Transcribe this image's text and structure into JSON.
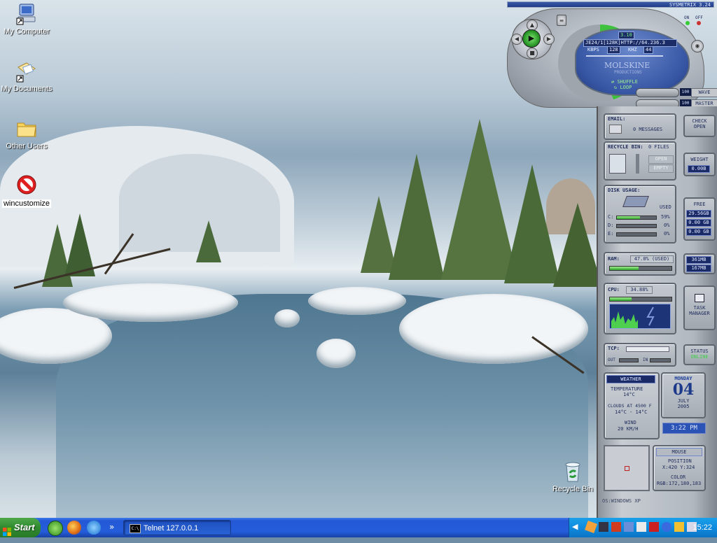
{
  "desktop": {
    "icons": [
      {
        "label": "My Computer",
        "icon": "my-computer-icon"
      },
      {
        "label": "My Documents",
        "icon": "my-documents-icon"
      },
      {
        "label": "Other Users",
        "icon": "folder-icon"
      },
      {
        "label": "wincustomize",
        "icon": "no-entry-icon"
      },
      {
        "label": "Recycle Bin",
        "icon": "recycle-bin-icon"
      }
    ]
  },
  "widget": {
    "title": "SYSMETRIX 3.24",
    "player": {
      "track_num": "3.10",
      "stream": "JE24/1[128K]HTTP://64.236.3",
      "kbps_label": "KBPS",
      "kbps": "128",
      "khz_label": "KHZ",
      "khz": "44",
      "logo_text": "MOLSKINE",
      "logo_sub": "PRODUCTIONS",
      "shuffle": "SHUFFLE",
      "loop": "LOOP",
      "on_label": "ON",
      "off_label": "OFF"
    },
    "volume": {
      "wave_value": "100",
      "wave_label": "WAVE",
      "master_value": "100",
      "master_label": "MASTER"
    },
    "email": {
      "title": "EMAIL:",
      "messages": "0 MESSAGES",
      "check": "CHECK",
      "open": "OPEN"
    },
    "recycle": {
      "title": "RECYCLE BIN:",
      "files": "0 FILES",
      "open": "OPEN",
      "empty": "EMPTY",
      "weight_label": "WEIGHT",
      "weight": "0.00B"
    },
    "disk": {
      "title": "DISK USAGE:",
      "used_label": "USED",
      "free_label": "FREE",
      "drives": [
        {
          "letter": "C:",
          "used": "59%",
          "used_fraction": 0.59,
          "free": "29.56GB"
        },
        {
          "letter": "D:",
          "used": "0%",
          "used_fraction": 0,
          "free": "0.00 GB"
        },
        {
          "letter": "E:",
          "used": "0%",
          "used_fraction": 0,
          "free": "0.00 GB"
        }
      ]
    },
    "ram": {
      "label": "RAM:",
      "value": "47.0% (USED)",
      "used_fraction": 0.47,
      "total": "361MB",
      "free": "167MB"
    },
    "cpu": {
      "label": "CPU:",
      "value": "34.88%",
      "used_fraction": 0.3488
    },
    "task_manager": {
      "line1": "TASK",
      "line2": "MANAGER"
    },
    "tcp": {
      "label": "TCP:",
      "out": "OUT",
      "in": "IN",
      "status_label": "STATUS",
      "status": "ONLINE"
    },
    "weather": {
      "title": "WEATHER",
      "temp_label": "TEMPERATURE",
      "temp": "14°C",
      "clouds": "CLOUDS AT 4500 F",
      "clouds_range": "14°C - 14°C",
      "wind_label": "WIND",
      "wind": "20 KM/H"
    },
    "date": {
      "day": "MONDAY",
      "date": "04",
      "month": "JULY",
      "year": "2005",
      "time": "3:22 PM"
    },
    "mouse": {
      "title": "MOUSE",
      "position_label": "POSITION",
      "position": "X:420 Y:324",
      "color_label": "COLOR",
      "color": "RGB:172,180,183"
    },
    "os": "OS:WINDOWS XP"
  },
  "taskbar": {
    "start": "Start",
    "task": "Telnet 127.0.0.1",
    "clock": "15:22",
    "colors": {
      "start": "#2f8a2f",
      "bar": "#245ddb",
      "tray": "#0f8bde"
    }
  }
}
